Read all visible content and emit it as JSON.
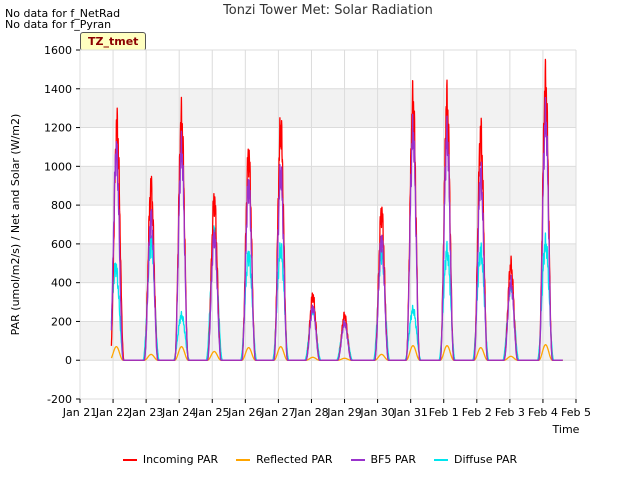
{
  "notes": [
    "No data for f_NetRad",
    "No data for f_Pyran"
  ],
  "badge": "TZ_tmet",
  "chart_data": {
    "type": "line",
    "title": "Tonzi Tower Met: Solar Radiation",
    "xlabel": "Time",
    "ylabel": "PAR (umol/m2/s) / Net and Solar (W/m2)",
    "ylim": [
      -200,
      1600
    ],
    "yticks": [
      -200,
      0,
      200,
      400,
      600,
      800,
      1000,
      1200,
      1400,
      1600
    ],
    "xlim": [
      0,
      15
    ],
    "xticks": [
      0,
      1,
      2,
      3,
      4,
      5,
      6,
      7,
      8,
      9,
      10,
      11,
      12,
      13,
      14,
      15
    ],
    "xtick_labels": [
      "Jan 21",
      "Jan 22",
      "Jan 23",
      "Jan 24",
      "Jan 25",
      "Jan 26",
      "Jan 27",
      "Jan 28",
      "Jan 29",
      "Jan 30",
      "Jan 31",
      "Feb 1",
      "Feb 2",
      "Feb 3",
      "Feb 4",
      "Feb 5"
    ],
    "x_units": "days since Jan 21",
    "grid": true,
    "legend_position": "bottom",
    "series": [
      {
        "name": "Incoming PAR",
        "color": "#ff0000",
        "peaks": [
          [
            1.12,
            1200
          ],
          [
            2.15,
            890
          ],
          [
            3.07,
            1240
          ],
          [
            4.06,
            820
          ],
          [
            5.1,
            1050
          ],
          [
            6.07,
            1190
          ],
          [
            7.04,
            330
          ],
          [
            8.0,
            230
          ],
          [
            9.12,
            760
          ],
          [
            10.07,
            1330
          ],
          [
            11.1,
            1320
          ],
          [
            12.12,
            1160
          ],
          [
            13.03,
            490
          ],
          [
            14.08,
            1420
          ]
        ]
      },
      {
        "name": "Reflected PAR",
        "color": "#ffa500",
        "peaks": [
          [
            1.1,
            70
          ],
          [
            2.15,
            30
          ],
          [
            3.07,
            70
          ],
          [
            4.06,
            45
          ],
          [
            5.1,
            65
          ],
          [
            6.07,
            70
          ],
          [
            7.04,
            15
          ],
          [
            8.0,
            10
          ],
          [
            9.12,
            30
          ],
          [
            10.07,
            75
          ],
          [
            11.1,
            75
          ],
          [
            12.12,
            65
          ],
          [
            13.03,
            20
          ],
          [
            14.08,
            80
          ]
        ]
      },
      {
        "name": "BF5 PAR",
        "color": "#9932cc",
        "peaks": [
          [
            1.1,
            1070
          ],
          [
            2.15,
            730
          ],
          [
            3.07,
            1080
          ],
          [
            4.06,
            640
          ],
          [
            5.1,
            900
          ],
          [
            6.07,
            960
          ],
          [
            7.04,
            270
          ],
          [
            8.0,
            190
          ],
          [
            9.12,
            620
          ],
          [
            10.07,
            1170
          ],
          [
            11.1,
            1150
          ],
          [
            12.12,
            950
          ],
          [
            13.03,
            400
          ],
          [
            14.08,
            1240
          ]
        ]
      },
      {
        "name": "Diffuse PAR",
        "color": "#00e5ee",
        "peaks": [
          [
            1.08,
            480
          ],
          [
            2.15,
            600
          ],
          [
            3.07,
            230
          ],
          [
            4.06,
            660
          ],
          [
            5.1,
            540
          ],
          [
            6.07,
            570
          ],
          [
            7.04,
            260
          ],
          [
            8.0,
            190
          ],
          [
            9.12,
            550
          ],
          [
            10.07,
            260
          ],
          [
            11.1,
            560
          ],
          [
            12.12,
            560
          ],
          [
            13.03,
            380
          ],
          [
            14.08,
            600
          ]
        ]
      }
    ]
  }
}
